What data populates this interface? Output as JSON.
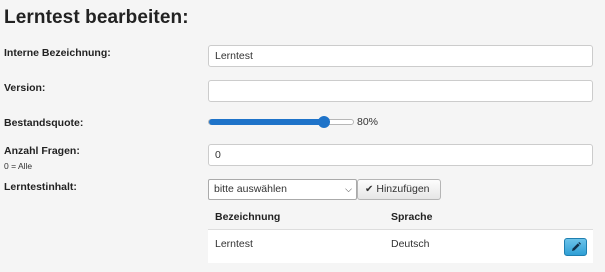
{
  "page": {
    "title": "Lerntest bearbeiten:"
  },
  "form": {
    "internal_name": {
      "label": "Interne Bezeichnung:",
      "value": "Lerntest"
    },
    "version": {
      "label": "Version:",
      "value": ""
    },
    "quota": {
      "label": "Bestandsquote:",
      "value_text": "80%",
      "value": 80,
      "min": 0,
      "max": 100
    },
    "question_count": {
      "label": "Anzahl Fragen:",
      "hint": "0 = Alle",
      "value": "0"
    },
    "content": {
      "label": "Lerntestinhalt:",
      "select_value": "bitte auswählen",
      "add_button_label": "Hinzufügen"
    }
  },
  "table": {
    "headers": [
      "Bezeichnung",
      "Sprache"
    ],
    "rows": [
      {
        "name": "Lerntest",
        "language": "Deutsch"
      }
    ]
  },
  "colors": {
    "accent": "#1e73c9",
    "edit_button": "#3aa6da"
  },
  "icons": {
    "add": "check-icon",
    "edit": "pencil-icon",
    "select": "chevron-down-icon"
  }
}
